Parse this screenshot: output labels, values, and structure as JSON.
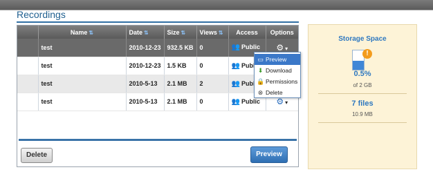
{
  "page": {
    "title": "Recordings"
  },
  "table": {
    "columns": [
      "",
      "Name",
      "Date",
      "Size",
      "Views",
      "Access",
      "Options"
    ],
    "rows": [
      {
        "name": "test",
        "date": "2010-12-23",
        "size": "932.5 KB",
        "views": "0",
        "access": "Public"
      },
      {
        "name": "test",
        "date": "2010-12-23",
        "size": "1.5 KB",
        "views": "0",
        "access": "Public"
      },
      {
        "name": "test",
        "date": "2010-5-13",
        "size": "2.1 MB",
        "views": "2",
        "access": "Public"
      },
      {
        "name": "test",
        "date": "2010-5-13",
        "size": "2.1 MB",
        "views": "0",
        "access": "Public"
      }
    ]
  },
  "menu": {
    "items": [
      "Preview",
      "Download",
      "Permissions",
      "Delete"
    ]
  },
  "actions": {
    "delete_label": "Delete",
    "preview_label": "Preview"
  },
  "storage": {
    "title": "Storage Space",
    "percent": "0.5%",
    "percent_value": 0.5,
    "quota": "of 2 GB",
    "files": "7 files",
    "files_size": "10.9 MB"
  },
  "colors": {
    "accent": "#2e78c0",
    "header": "#5a5a5a",
    "selected_row": "#6a6a6a",
    "menu_active": "#3b78c8"
  },
  "icons": {
    "sort": "sort-arrows-icon",
    "access": "users-icon",
    "options": "gear-icon",
    "warning": "warning-icon",
    "storage": "disk-icon"
  }
}
